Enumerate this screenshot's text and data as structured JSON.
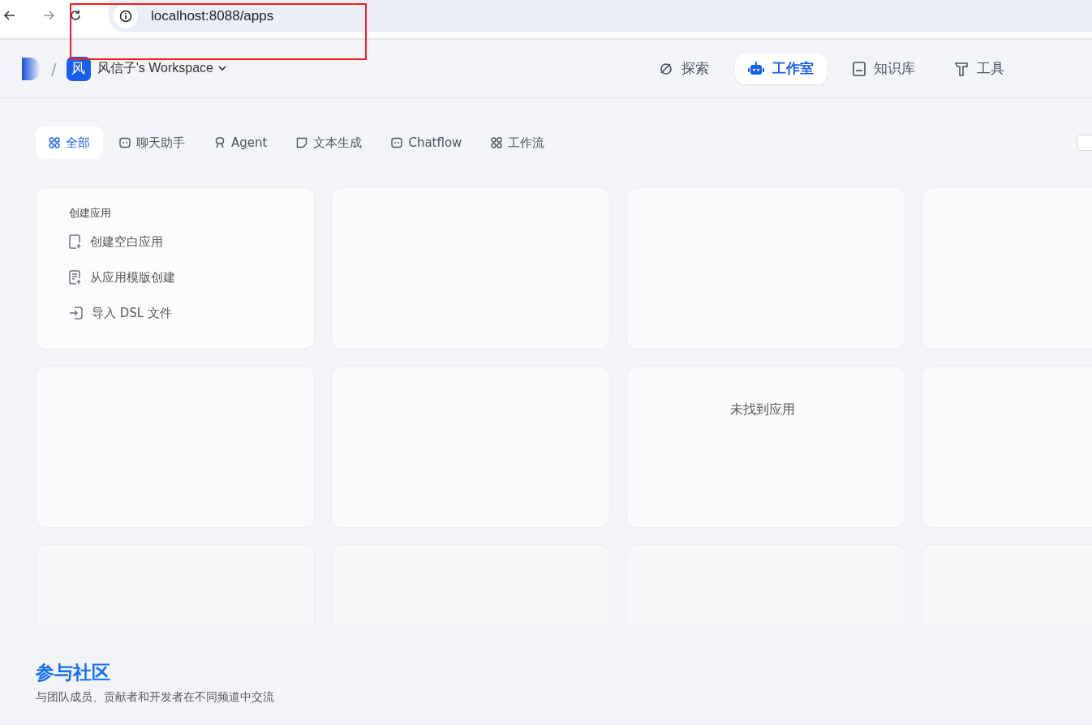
{
  "browser": {
    "url": "localhost:8088/apps"
  },
  "header": {
    "separator": "/",
    "workspace_initial": "风",
    "workspace_name": "风信子's Workspace",
    "nav": [
      {
        "label": "探索",
        "kind": "explore",
        "selected": false
      },
      {
        "label": "工作室",
        "kind": "studio",
        "selected": true
      },
      {
        "label": "知识库",
        "kind": "knowledge",
        "selected": false
      },
      {
        "label": "工具",
        "kind": "tools",
        "selected": false
      }
    ]
  },
  "tabs": [
    {
      "label": "全部",
      "kind": "all",
      "selected": true
    },
    {
      "label": "聊天助手",
      "kind": "chat",
      "selected": false
    },
    {
      "label": "Agent",
      "kind": "agent",
      "selected": false
    },
    {
      "label": "文本生成",
      "kind": "text",
      "selected": false
    },
    {
      "label": "Chatflow",
      "kind": "chat",
      "selected": false
    },
    {
      "label": "工作流",
      "kind": "workflow",
      "selected": false
    }
  ],
  "filter_checkbox": {
    "checked": false
  },
  "create_card": {
    "title": "创建应用",
    "actions": [
      {
        "label": "创建空白应用",
        "kind": "blank"
      },
      {
        "label": "从应用模版创建",
        "kind": "template"
      },
      {
        "label": "导入 DSL 文件",
        "kind": "import"
      }
    ]
  },
  "empty_state": "未找到应用",
  "footer": {
    "title": "参与社区",
    "subtitle": "与团队成员、贡献者和开发者在不同频道中交流"
  }
}
